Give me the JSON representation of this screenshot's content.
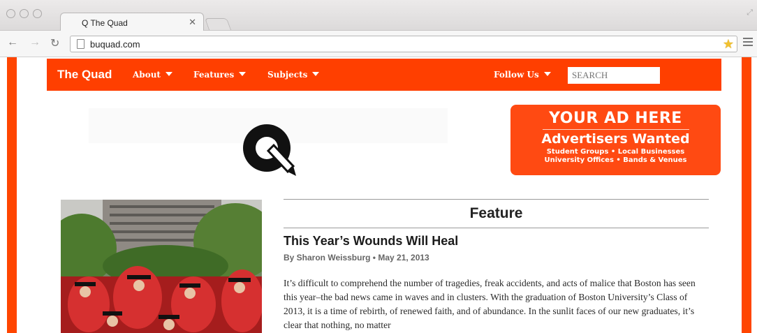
{
  "browser": {
    "tab_title": "Q The Quad",
    "url": "buquad.com"
  },
  "nav": {
    "brand": "The Quad",
    "items": [
      "About",
      "Features",
      "Subjects"
    ],
    "follow": "Follow Us",
    "search_placeholder": "SEARCH"
  },
  "ad": {
    "line1": "YOUR AD HERE",
    "line2": "Advertisers Wanted",
    "line3": "Student Groups • Local Businesses",
    "line4": "University Offices • Bands & Venues"
  },
  "feature": {
    "heading": "Feature",
    "title": "This Year’s Wounds Will Heal",
    "byline": "By Sharon Weissburg • May 21, 2013",
    "excerpt": "It’s difficult to comprehend the number of tragedies, freak accidents, and acts of malice that Boston has seen this year–the bad news came in waves and in clusters. With the graduation of Boston University’s Class of 2013, it is a time of rebirth, of renewed faith, and of abundance. In the sunlit faces of our new graduates, it’s clear that nothing, no matter"
  },
  "colors": {
    "brand_orange": "#ff3f00",
    "ad_orange": "#ff4a12"
  }
}
